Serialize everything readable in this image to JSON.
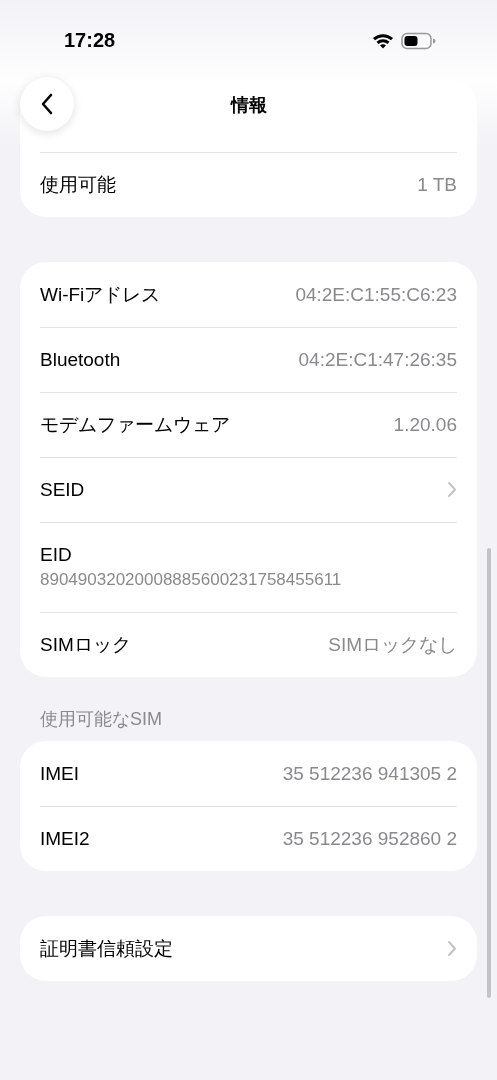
{
  "status_bar": {
    "time": "17:28"
  },
  "nav": {
    "title": "情報"
  },
  "sections": [
    {
      "rows": [
        {
          "kind": "value",
          "label": "使用可能",
          "value": "1 TB"
        }
      ]
    },
    {
      "rows": [
        {
          "kind": "value",
          "label": "Wi-Fiアドレス",
          "value": "04:2E:C1:55:C6:23"
        },
        {
          "kind": "value",
          "label": "Bluetooth",
          "value": "04:2E:C1:47:26:35"
        },
        {
          "kind": "value",
          "label": "モデムファームウェア",
          "value": "1.20.06"
        },
        {
          "kind": "chevron",
          "label": "SEID"
        },
        {
          "kind": "stacked",
          "label": "EID",
          "value": "89049032020008885600231758455611"
        },
        {
          "kind": "value",
          "label": "SIMロック",
          "value": "SIMロックなし"
        }
      ]
    },
    {
      "header": "使用可能なSIM",
      "rows": [
        {
          "kind": "value",
          "label": "IMEI",
          "value": "35 512236 941305 2"
        },
        {
          "kind": "value",
          "label": "IMEI2",
          "value": "35 512236 952860 2"
        }
      ]
    },
    {
      "rows": [
        {
          "kind": "chevron",
          "label": "証明書信頼設定"
        }
      ]
    }
  ]
}
